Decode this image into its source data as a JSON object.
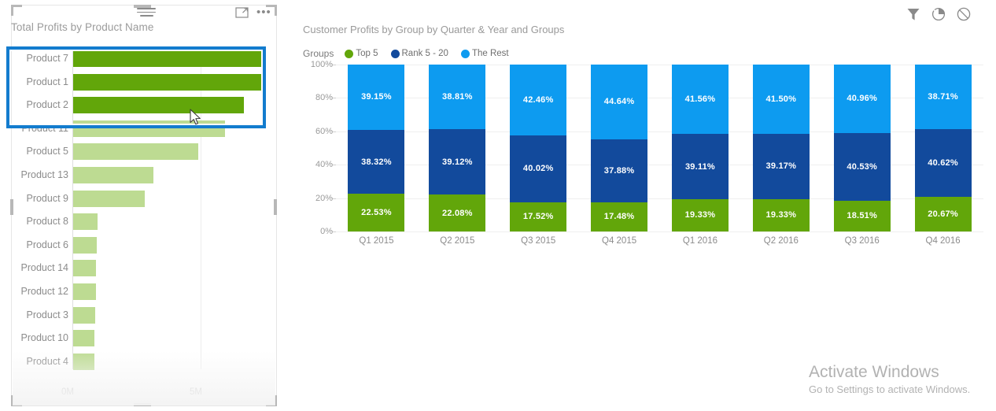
{
  "left_visual": {
    "title": "Total Profits by Product Name",
    "icons": {
      "sort": "sort-icon",
      "focus": "focus-mode-icon",
      "more": "more-options-icon",
      "more_glyph": "•••"
    },
    "x_axis": {
      "ticks": [
        "0M",
        "5M"
      ]
    },
    "selection": {
      "selected_labels": [
        "Product 7",
        "Product 1",
        "Product 2"
      ]
    },
    "colors": {
      "selected_bar": "#62a60a",
      "dimmed_bar": "#bddb92",
      "selection_border": "#137cce"
    }
  },
  "right_visual": {
    "title": "Customer Profits by Group by Quarter & Year and Groups",
    "legend_caption": "Groups",
    "icons": {
      "filter": "filter-icon",
      "focus": "focus-mode-icon",
      "block": "no-entry-icon"
    }
  },
  "watermark": {
    "title": "Activate Windows",
    "subtitle": "Go to Settings to activate Windows."
  },
  "chart_data": [
    {
      "type": "bar",
      "title": "Total Profits by Product Name",
      "orientation": "horizontal",
      "xlabel": "",
      "ylabel": "",
      "xlim": [
        0,
        10
      ],
      "tick_labels": [
        "0M",
        "5M"
      ],
      "grid": true,
      "categories": [
        "Product 7",
        "Product 1",
        "Product 2",
        "Product 11",
        "Product 5",
        "Product 13",
        "Product 9",
        "Product 8",
        "Product 6",
        "Product 14",
        "Product 12",
        "Product 3",
        "Product 10",
        "Product 4"
      ],
      "values": [
        7.55,
        7.4,
        6.7,
        5.95,
        4.9,
        3.15,
        2.8,
        0.95,
        0.93,
        0.9,
        0.88,
        0.86,
        0.84,
        0.82
      ],
      "value_units": "millions",
      "highlighted": [
        "Product 7",
        "Product 1",
        "Product 2"
      ],
      "colors": {
        "highlighted": "#62a60a",
        "dimmed": "#bddb92"
      }
    },
    {
      "type": "bar",
      "subtype": "stacked-100-percent",
      "title": "Customer Profits by Group by Quarter & Year and Groups",
      "xlabel": "",
      "ylabel": "",
      "ylim": [
        0,
        100
      ],
      "y_tick_labels": [
        "0%",
        "20%",
        "40%",
        "60%",
        "80%",
        "100%"
      ],
      "grid": true,
      "legend_position": "top-left",
      "categories": [
        "Q1 2015",
        "Q2 2015",
        "Q3 2015",
        "Q4 2015",
        "Q1 2016",
        "Q2 2016",
        "Q3 2016",
        "Q4 2016"
      ],
      "series": [
        {
          "name": "Top 5",
          "color": "#62a60a",
          "values": [
            22.53,
            22.08,
            17.52,
            17.48,
            19.33,
            19.33,
            18.51,
            20.67
          ],
          "labels": [
            "22.53%",
            "22.08%",
            "17.52%",
            "17.48%",
            "19.33%",
            "19.33%",
            "18.51%",
            "20.67%"
          ]
        },
        {
          "name": "Rank 5 - 20",
          "color": "#124a9c",
          "values": [
            38.32,
            39.12,
            40.02,
            37.88,
            39.11,
            39.17,
            40.53,
            40.62
          ],
          "labels": [
            "38.32%",
            "39.12%",
            "40.02%",
            "37.88%",
            "39.11%",
            "39.17%",
            "40.53%",
            "40.62%"
          ]
        },
        {
          "name": "The Rest",
          "color": "#0d9bf0",
          "values": [
            39.15,
            38.81,
            42.46,
            44.64,
            41.56,
            41.5,
            40.96,
            38.71
          ],
          "labels": [
            "39.15%",
            "38.81%",
            "42.46%",
            "44.64%",
            "41.56%",
            "41.50%",
            "40.96%",
            "38.71%"
          ]
        }
      ]
    }
  ]
}
